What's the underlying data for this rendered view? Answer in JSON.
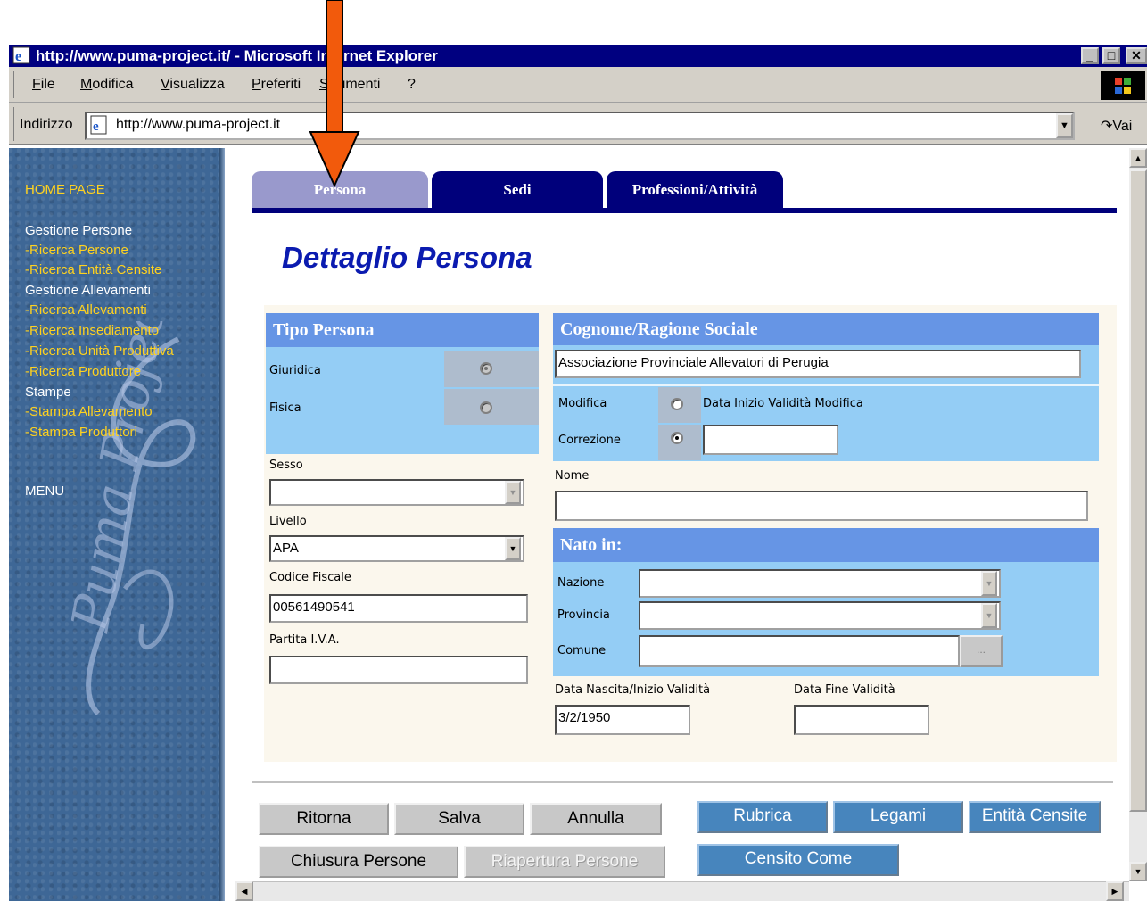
{
  "window": {
    "title": "http://www.puma-project.it/ - Microsoft Internet Explorer"
  },
  "menubar": [
    "File",
    "Modifica",
    "Visualizza",
    "Preferiti",
    "Strumenti",
    "?"
  ],
  "address": {
    "label": "Indirizzo",
    "url": "http://www.puma-project.it",
    "go_label": "Vai"
  },
  "sidebar": {
    "home": "HOME PAGE",
    "sections": [
      {
        "title": "Gestione Persone",
        "links": [
          "-Ricerca Persone",
          "-Ricerca Entità Censite"
        ]
      },
      {
        "title": "Gestione Allevamenti",
        "links": [
          "-Ricerca Allevamenti",
          "-Ricerca Insediamento",
          "-Ricerca Unità Produttiva",
          "-Ricerca Produttore"
        ]
      },
      {
        "title": "Stampe",
        "links": [
          "-Stampa Allevamento",
          "-Stampa Produttori"
        ]
      }
    ],
    "menu": "MENU",
    "logo_text": "Puma Project"
  },
  "tabs": [
    "Persona",
    "Sedi",
    "Professioni/Attività"
  ],
  "page_title": "Dettaglio Persona",
  "tipo_persona": {
    "header": "Tipo Persona",
    "options": [
      {
        "label": "Giuridica",
        "checked": true
      },
      {
        "label": "Fisica",
        "checked": false
      }
    ]
  },
  "sesso": {
    "label": "Sesso",
    "value": ""
  },
  "livello": {
    "label": "Livello",
    "value": "APA"
  },
  "codice_fiscale": {
    "label": "Codice Fiscale",
    "value": "00561490541"
  },
  "partita_iva": {
    "label": "Partita I.V.A.",
    "value": ""
  },
  "cognome": {
    "header": "Cognome/Ragione Sociale",
    "value": "Associazione Provinciale Allevatori di Perugia",
    "modifica_label": "Modifica",
    "data_inizio_label": "Data Inizio Validità Modifica",
    "correzione_label": "Correzione",
    "data_inizio_value": ""
  },
  "nome": {
    "label": "Nome",
    "value": ""
  },
  "nato_in": {
    "header": "Nato in:",
    "nazione_label": "Nazione",
    "nazione_value": "",
    "provincia_label": "Provincia",
    "provincia_value": "",
    "comune_label": "Comune",
    "comune_value": "",
    "ellipsis": "..."
  },
  "data_nascita": {
    "label": "Data Nascita/Inizio Validità",
    "value": "3/2/1950"
  },
  "data_fine": {
    "label": "Data Fine Validità",
    "value": ""
  },
  "buttons": {
    "ritorna": "Ritorna",
    "salva": "Salva",
    "annulla": "Annulla",
    "chiusura": "Chiusura Persone",
    "riapertura": "Riapertura Persone",
    "rubrica": "Rubrica",
    "legami": "Legami",
    "entita": "Entità Censite",
    "censito": "Censito Come"
  },
  "colors": {
    "tab_active": "#9999cc",
    "tab_inactive": "#00007b",
    "header_blue": "#6695e5",
    "light_blue": "#94cdf5",
    "sidebar_bg": "#3e6796",
    "link_yellow": "#ffd21f",
    "annotation_arrow": "#f25a0c"
  }
}
